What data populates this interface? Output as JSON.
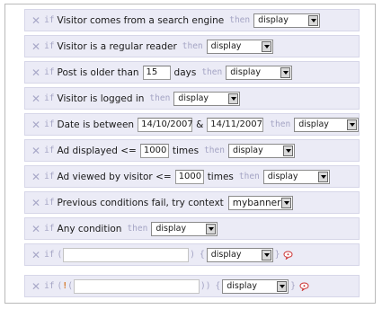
{
  "keywords": {
    "if": "if",
    "then": "then",
    "open_paren": "(",
    "close_paren": ")",
    "double_close_paren": "))",
    "open_brace": "{",
    "close_brace": "}",
    "not": "!"
  },
  "remove_symbol": "✕",
  "rules": {
    "search_engine": {
      "text": "Visitor comes from a search engine",
      "action": "display"
    },
    "regular_reader": {
      "text": "Visitor is a regular reader",
      "action": "display"
    },
    "post_older": {
      "text_before": "Post is older than",
      "value": "15",
      "text_after": "days",
      "action": "display"
    },
    "logged_in": {
      "text": "Visitor is logged in",
      "action": "display"
    },
    "date_between": {
      "text": "Date is between",
      "date_from": "14/10/2007",
      "joiner": "&",
      "date_to": "14/11/2007",
      "action": "display"
    },
    "ad_displayed": {
      "text": "Ad displayed <=",
      "value": "1000",
      "unit": "times",
      "action": "display"
    },
    "ad_viewed": {
      "text": "Ad viewed by visitor <=",
      "value": "1000",
      "unit": "times",
      "action": "display"
    },
    "previous_fail": {
      "text": "Previous conditions fail, try context",
      "context": "mybanner"
    },
    "any_condition": {
      "text": "Any condition",
      "action": "display"
    },
    "custom": {
      "expression": "",
      "action": "display"
    },
    "custom_not": {
      "expression": "",
      "action": "display"
    }
  },
  "colors": {
    "row_bg": "#ebebf6",
    "keyword": "#a4a4c4",
    "not_operator": "#d6792b",
    "help_icon": "#cc3333"
  },
  "icons": {
    "remove": "close-icon",
    "help": "speech-bubble-icon"
  }
}
